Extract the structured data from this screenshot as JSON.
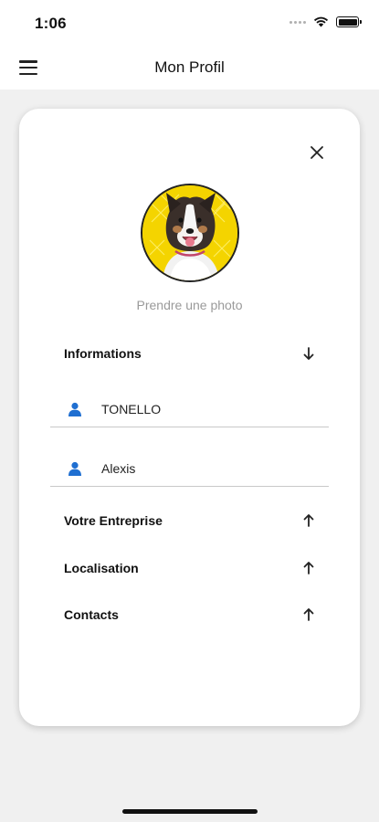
{
  "status_bar": {
    "time": "1:06"
  },
  "nav": {
    "title": "Mon Profil",
    "menu_icon": "hamburger-menu-icon"
  },
  "profile": {
    "close_icon": "close-icon",
    "avatar_description": "dog-photo-avatar",
    "photo_action_label": "Prendre une photo"
  },
  "sections": {
    "informations": {
      "label": "Informations",
      "icon": "arrow-down-icon"
    },
    "entreprise": {
      "label": "Votre Entreprise",
      "icon": "arrow-up-icon"
    },
    "localisation": {
      "label": "Localisation",
      "icon": "arrow-up-icon"
    },
    "contacts": {
      "label": "Contacts",
      "icon": "arrow-up-icon"
    }
  },
  "fields": {
    "last_name": {
      "value": "TONELLO",
      "icon": "person-icon"
    },
    "first_name": {
      "value": "Alexis",
      "icon": "person-icon"
    }
  },
  "colors": {
    "accent_blue": "#1f6fd1",
    "avatar_background": "#f4d400",
    "muted_text": "#9a9a9a"
  }
}
